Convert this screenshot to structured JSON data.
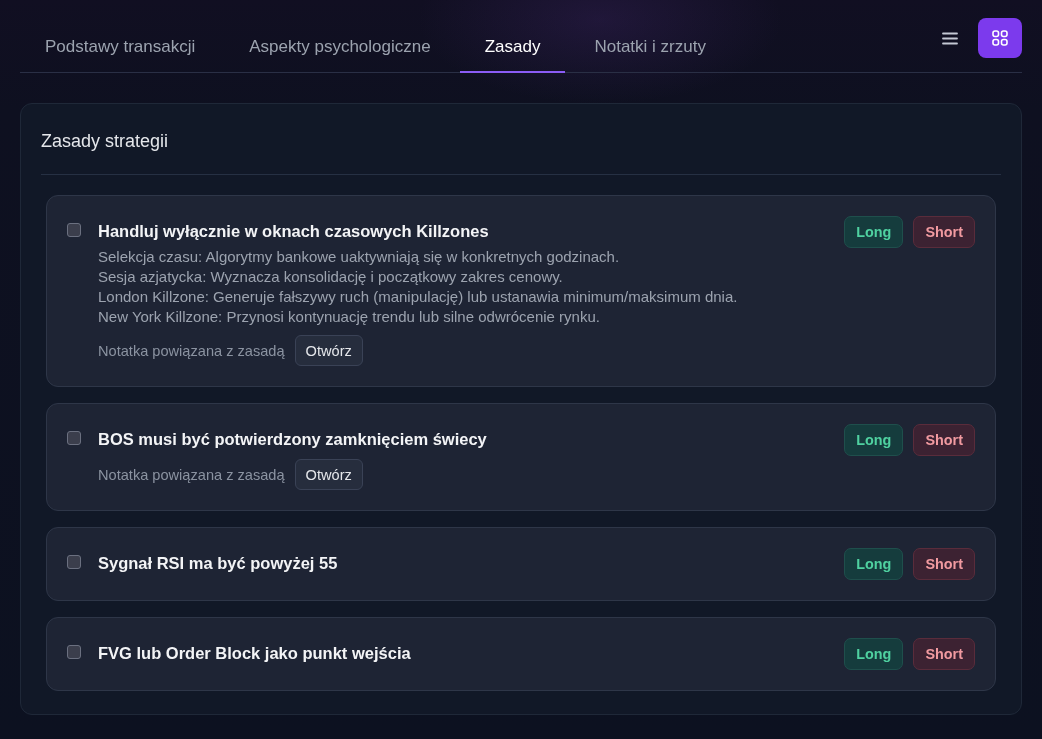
{
  "tabs": [
    {
      "label": "Podstawy transakcji",
      "selected": false
    },
    {
      "label": "Aspekty psychologiczne",
      "selected": false
    },
    {
      "label": "Zasady",
      "selected": true
    },
    {
      "label": "Notatki i zrzuty",
      "selected": false
    }
  ],
  "view_toggle": [
    {
      "kind": "list",
      "selected": false
    },
    {
      "kind": "grid",
      "selected": true
    }
  ],
  "panel": {
    "title": "Zasady strategii",
    "rules": [
      {
        "title": "Handluj wyłącznie w oknach czasowych Killzones",
        "checked": false,
        "description": [
          "Selekcja czasu: Algorytmy bankowe uaktywniają się w konkretnych godzinach.",
          "Sesja azjatycka: Wyznacza konsolidację i początkowy zakres cenowy.",
          "London Killzone: Generuje fałszywy ruch (manipulację) lub ustanawia minimum/maksimum dnia.",
          "New York Killzone: Przynosi kontynuację trendu lub silne odwrócenie rynku."
        ],
        "note": {
          "label": "Notatka powiązana z zasadą",
          "button": "Otwórz"
        },
        "directions": [
          {
            "kind": "long",
            "label": "Long"
          },
          {
            "kind": "short",
            "label": "Short"
          }
        ]
      },
      {
        "title": "BOS musi być potwierdzony zamknięciem świecy",
        "checked": false,
        "note": {
          "label": "Notatka powiązana z zasadą",
          "button": "Otwórz"
        },
        "directions": [
          {
            "kind": "long",
            "label": "Long"
          },
          {
            "kind": "short",
            "label": "Short"
          }
        ]
      },
      {
        "title": "Sygnał RSI ma być powyżej 55",
        "checked": false,
        "directions": [
          {
            "kind": "long",
            "label": "Long"
          },
          {
            "kind": "short",
            "label": "Short"
          }
        ]
      },
      {
        "title": "FVG lub Order Block jako punkt wejścia",
        "checked": false,
        "directions": [
          {
            "kind": "long",
            "label": "Long"
          },
          {
            "kind": "short",
            "label": "Short"
          }
        ]
      }
    ]
  }
}
